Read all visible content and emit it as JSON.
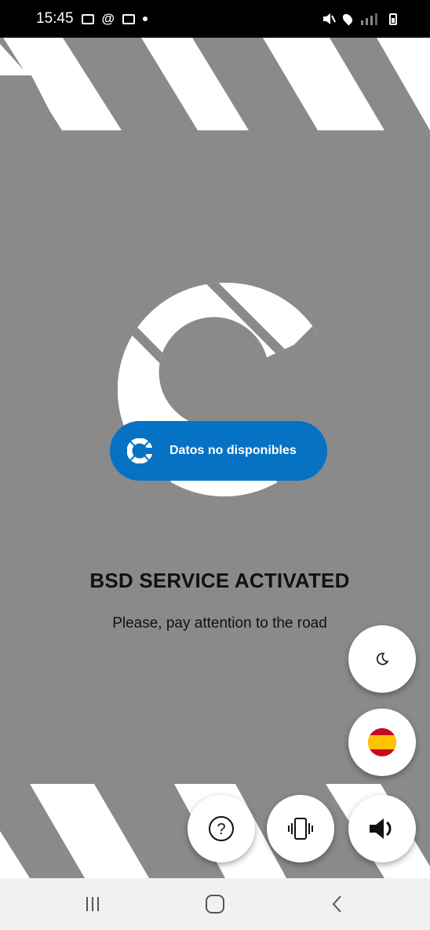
{
  "status_bar": {
    "time": "15:45",
    "icons_left": [
      "gallery-icon",
      "at-icon",
      "message-icon",
      "dot-icon"
    ],
    "icons_right": [
      "mute-icon",
      "location-icon",
      "signal-icon",
      "battery-icon"
    ]
  },
  "toast": {
    "text": "Datos no disponibles",
    "icon": "app-logo-icon",
    "color": "#0572c4"
  },
  "main": {
    "headline": "BSD SERVICE ACTIVATED",
    "subline": "Please, pay attention to the road",
    "background_color": "#8a8a8a"
  },
  "fabs": [
    {
      "name": "night-mode-button",
      "icon": "moon-icon"
    },
    {
      "name": "language-button",
      "icon": "spain-flag-icon"
    },
    {
      "name": "help-button",
      "icon": "question-icon"
    },
    {
      "name": "vibration-button",
      "icon": "vibrate-icon"
    },
    {
      "name": "sound-button",
      "icon": "speaker-icon"
    }
  ],
  "nav_bar": {
    "buttons": [
      "recent-apps-icon",
      "home-icon",
      "back-icon"
    ]
  }
}
